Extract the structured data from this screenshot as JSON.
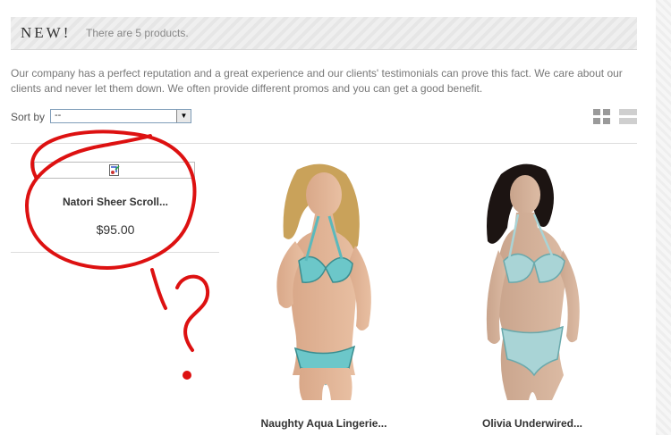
{
  "header": {
    "title": "NEW!",
    "count_text": "There are 5 products."
  },
  "intro": "Our company has a perfect reputation and a great experience and our clients' testimonials can prove this fact. We care about our clients and never let them down. We often provide different promos and you can get a good benefit.",
  "sort": {
    "label": "Sort by",
    "selected": "--"
  },
  "view_modes": [
    "grid-icon",
    "list-icon"
  ],
  "products": [
    {
      "name": "Natori Sheer Scroll...",
      "price": "$95.00",
      "image": "broken-image-icon"
    },
    {
      "name": "Naughty Aqua Lingerie...",
      "image": "aqua-bikini-photo"
    },
    {
      "name": "Olivia Underwired...",
      "image": "light-blue-lingerie-photo"
    }
  ],
  "annotation": {
    "color": "#dd1111"
  }
}
